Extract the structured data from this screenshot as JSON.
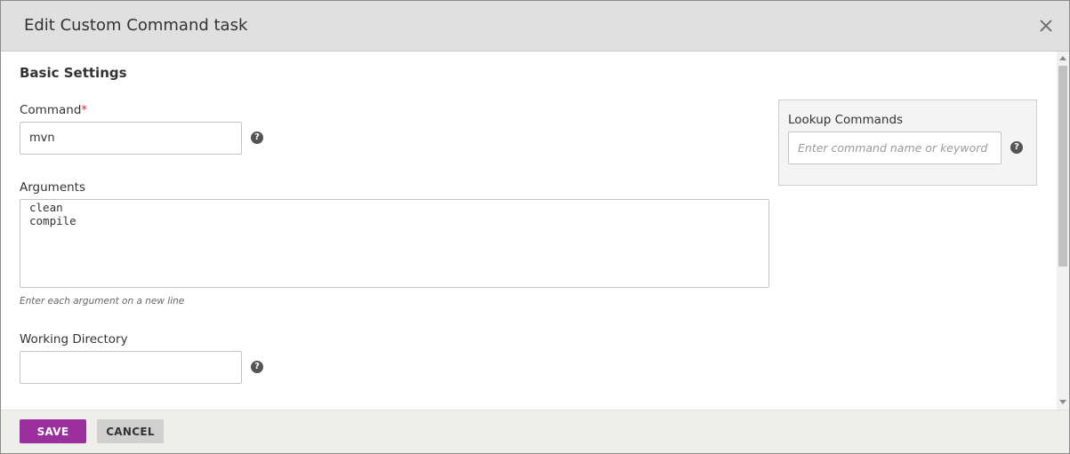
{
  "dialog": {
    "title": "Edit Custom Command task",
    "close_icon": "close-icon"
  },
  "basic_settings": {
    "section_title": "Basic Settings",
    "command": {
      "label": "Command",
      "required_mark": "*",
      "value": "mvn",
      "help_icon": "question-circle-icon"
    },
    "arguments": {
      "label": "Arguments",
      "value": "clean\ncompile",
      "hint": "Enter each argument on a new line"
    },
    "working_directory": {
      "label": "Working Directory",
      "value": "",
      "help_icon": "question-circle-icon"
    }
  },
  "lookup": {
    "label": "Lookup Commands",
    "placeholder": "Enter command name or keyword",
    "value": "",
    "help_icon": "question-circle-icon"
  },
  "footer": {
    "save_label": "SAVE",
    "cancel_label": "CANCEL"
  },
  "colors": {
    "primary": "#9a2f9d",
    "required": "#c9302c",
    "header_bg": "#e0e0e0",
    "footer_bg": "#eeeeea"
  }
}
